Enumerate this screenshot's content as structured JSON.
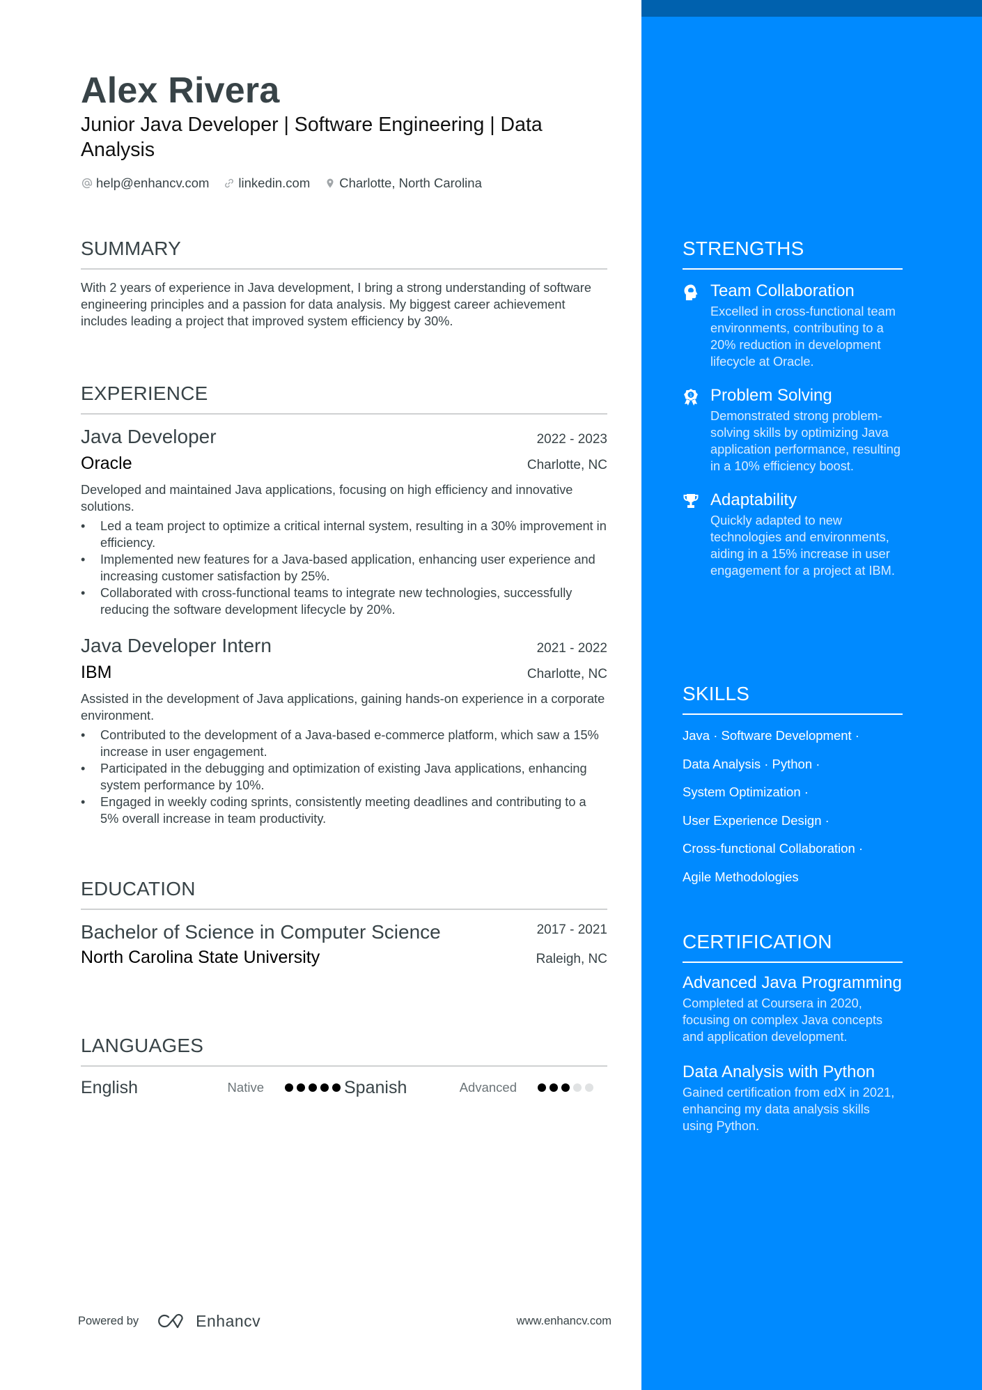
{
  "header": {
    "name": "Alex Rivera",
    "headline": "Junior Java Developer | Software Engineering | Data Analysis",
    "contacts": [
      {
        "icon": "at-icon",
        "text": "help@enhancv.com"
      },
      {
        "icon": "link-icon",
        "text": "linkedin.com"
      },
      {
        "icon": "location-pin-icon",
        "text": "Charlotte, North Carolina"
      }
    ]
  },
  "summary": {
    "title": "SUMMARY",
    "text": "With 2 years of experience in Java development, I bring a strong understanding of software engineering principles and a passion for data analysis. My biggest career achievement includes leading a project that improved system efficiency by 30%."
  },
  "experience": {
    "title": "EXPERIENCE",
    "jobs": [
      {
        "title": "Java Developer",
        "dates": "2022 - 2023",
        "company": "Oracle",
        "location": "Charlotte, NC",
        "description": "Developed and maintained Java applications, focusing on high efficiency and innovative solutions.",
        "bullets": [
          "Led a team project to optimize a critical internal system, resulting in a 30% improvement in efficiency.",
          "Implemented new features for a Java-based application, enhancing user experience and increasing customer satisfaction by 25%.",
          "Collaborated with cross-functional teams to integrate new technologies, successfully reducing the software development lifecycle by 20%."
        ]
      },
      {
        "title": "Java Developer Intern",
        "dates": "2021 - 2022",
        "company": "IBM",
        "location": "Charlotte, NC",
        "description": "Assisted in the development of Java applications, gaining hands-on experience in a corporate environment.",
        "bullets": [
          "Contributed to the development of a Java-based e-commerce platform, which saw a 15% increase in user engagement.",
          "Participated in the debugging and optimization of existing Java applications, enhancing system performance by 10%.",
          "Engaged in weekly coding sprints, consistently meeting deadlines and contributing to a 5% overall increase in team productivity."
        ]
      }
    ]
  },
  "education": {
    "title": "EDUCATION",
    "items": [
      {
        "degree": "Bachelor of Science in Computer Science",
        "dates": "2017 - 2021",
        "school": "North Carolina State University",
        "location": "Raleigh, NC"
      }
    ]
  },
  "languages": {
    "title": "LANGUAGES",
    "items": [
      {
        "name": "English",
        "level": "Native",
        "rating": 5,
        "max": 5
      },
      {
        "name": "Spanish",
        "level": "Advanced",
        "rating": 3,
        "max": 5
      }
    ]
  },
  "footer": {
    "powered_by": "Powered by",
    "brand": "Enhancv",
    "website": "www.enhancv.com"
  },
  "strengths": {
    "title": "STRENGTHS",
    "items": [
      {
        "icon": "head-brain-icon",
        "title": "Team Collaboration",
        "description": "Excelled in cross-functional team environments, contributing to a 20% reduction in development lifecycle at Oracle."
      },
      {
        "icon": "award-ribbon-icon",
        "title": "Problem Solving",
        "description": "Demonstrated strong problem-solving skills by optimizing Java application performance, resulting in a 10% efficiency boost."
      },
      {
        "icon": "trophy-icon",
        "title": "Adaptability",
        "description": "Quickly adapted to new technologies and environments, aiding in a 15% increase in user engagement for a project at IBM."
      }
    ]
  },
  "skills": {
    "title": "SKILLS",
    "lines": [
      "Java · Software Development ·",
      "Data Analysis · Python ·",
      "System Optimization ·",
      "User Experience Design ·",
      "Cross-functional Collaboration ·",
      "Agile Methodologies"
    ]
  },
  "certification": {
    "title": "CERTIFICATION",
    "items": [
      {
        "title": "Advanced Java Programming",
        "description": "Completed at Coursera in 2020, focusing on complex Java concepts and application development."
      },
      {
        "title": "Data Analysis with Python",
        "description": "Gained certification from edX in 2021, enhancing my data analysis skills using Python."
      }
    ]
  },
  "colors": {
    "sidebar": "#008aff",
    "sidebar_top": "#0061ae",
    "text": "#384347"
  }
}
